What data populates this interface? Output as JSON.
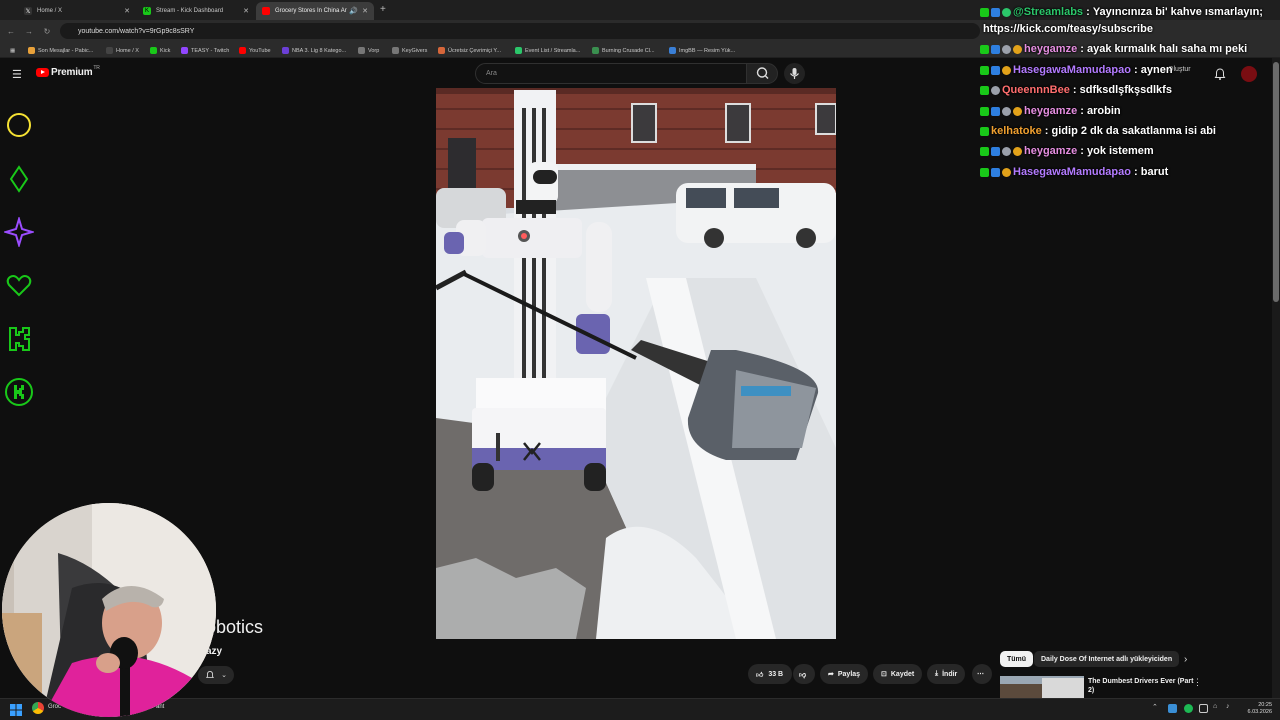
{
  "browser": {
    "tabs": [
      {
        "label": "Home / X",
        "icon": "x-logo-icon"
      },
      {
        "label": "Stream - Kick Dashboard",
        "icon": "kick-icon"
      },
      {
        "label": "Grocery Stores In China Ar",
        "icon": "youtube-icon"
      }
    ],
    "url": "youtube.com/watch?v=9rGp9c8sSRY",
    "bookmarks": [
      {
        "label": "Son Mesajlar - Pabic...",
        "color": "#e8a13a"
      },
      {
        "label": "Home / X",
        "color": "#444444"
      },
      {
        "label": "Kick",
        "color": "#19c819"
      },
      {
        "label": "TEASY - Twitch",
        "color": "#9146ff"
      },
      {
        "label": "YouTube",
        "color": "#ff0000"
      },
      {
        "label": "NBA 3. Lig 8 Katego...",
        "color": "#6b3fd6"
      },
      {
        "label": "Vorp",
        "color": "#777777"
      },
      {
        "label": "KeyGivers",
        "color": "#777777"
      },
      {
        "label": "Ücretsiz Çevrimiçi Y...",
        "color": "#d6663a"
      },
      {
        "label": "Event List / Streamla...",
        "color": "#2bc66a"
      },
      {
        "label": "Burning Crusade Cl...",
        "color": "#3a8f4f"
      },
      {
        "label": "ImgBB — Resim Yük...",
        "color": "#3a7fd6"
      }
    ]
  },
  "youtube": {
    "logo_text": "Premium",
    "logo_sup": "TR",
    "search_placeholder": "Ara",
    "create_label": "Oluştur",
    "video_title_fragment": "obotics",
    "channel_fragment": "azy",
    "actions": {
      "likes": "33 B",
      "share": "Paylaş",
      "save": "Kaydet",
      "download": "İndir"
    },
    "chips": [
      "Tümü",
      "Daily Dose Of Internet adlı yükleyiciden"
    ],
    "rec_title_line1": "The Dumbest Drivers Ever (Part",
    "rec_title_line2": "2)"
  },
  "chat": [
    {
      "user": "@Streamlabs",
      "message": "Yayıncınıza bi' kahve ısmarlayın;",
      "color": "#2bc66a"
    },
    {
      "user": "",
      "message": "https://kick.com/teasy/subscribe",
      "color": "#ffffff"
    },
    {
      "user": "heygamze",
      "message": "ayak kırmalık halı saha mı peki",
      "color": "#e58ee0"
    },
    {
      "user": "HasegawaMamudapao",
      "message": "aynen",
      "color": "#b37bff"
    },
    {
      "user": "QueennnBee",
      "message": "sdfksdlşfkşsdlkfs",
      "color": "#ff6e6e"
    },
    {
      "user": "heygamze",
      "message": "arobin",
      "color": "#e58ee0"
    },
    {
      "user": "kelhatoke",
      "message": "gidip 2 dk da sakatlanma isi abi",
      "color": "#f0a030"
    },
    {
      "user": "heygamze",
      "message": "yok istemem",
      "color": "#e58ee0"
    },
    {
      "user": "HasegawaMamudapao",
      "message": "barut",
      "color": "#b37bff"
    }
  ],
  "chat_separator": " : ",
  "taskbar": {
    "time": "20:25",
    "date": "6.03.2026",
    "app_label": "Groc",
    "app_label2": "ant"
  },
  "colors": {
    "accent_red": "#ff0000",
    "neon_yellow": "#f5e133",
    "neon_green": "#19c819",
    "neon_purple": "#9b4dff"
  }
}
